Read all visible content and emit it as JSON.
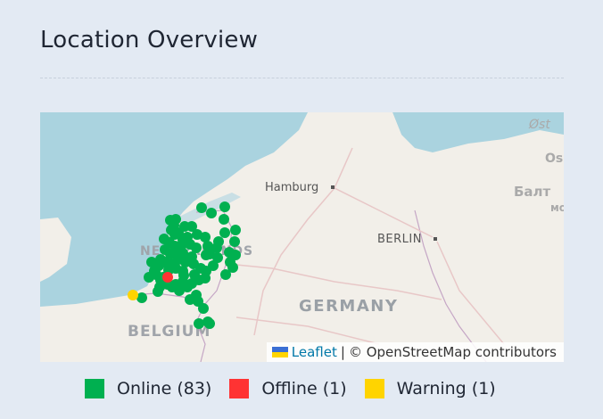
{
  "header": {
    "title": "Location Overview"
  },
  "map": {
    "labels": {
      "hamburg": "Hamburg",
      "berlin": "BERLIN",
      "germany": "GERMANY",
      "belgium": "BELGIUM",
      "netherlands": "NETHERLANDS",
      "ost": "Øst",
      "os": "Os",
      "balt": "Балт",
      "mo": "мо"
    },
    "attribution": {
      "leaflet": "Leaflet",
      "separator": "|",
      "osm": "© OpenStreetMap contributors"
    },
    "marker_colors": {
      "online": "#00b050",
      "offline": "#ff3333",
      "warning": "#ffd400"
    }
  },
  "legend": {
    "items": [
      {
        "label": "Online (83)",
        "color": "#00b050"
      },
      {
        "label": "Offline (1)",
        "color": "#ff3333"
      },
      {
        "label": "Warning (1)",
        "color": "#ffd400"
      }
    ]
  }
}
